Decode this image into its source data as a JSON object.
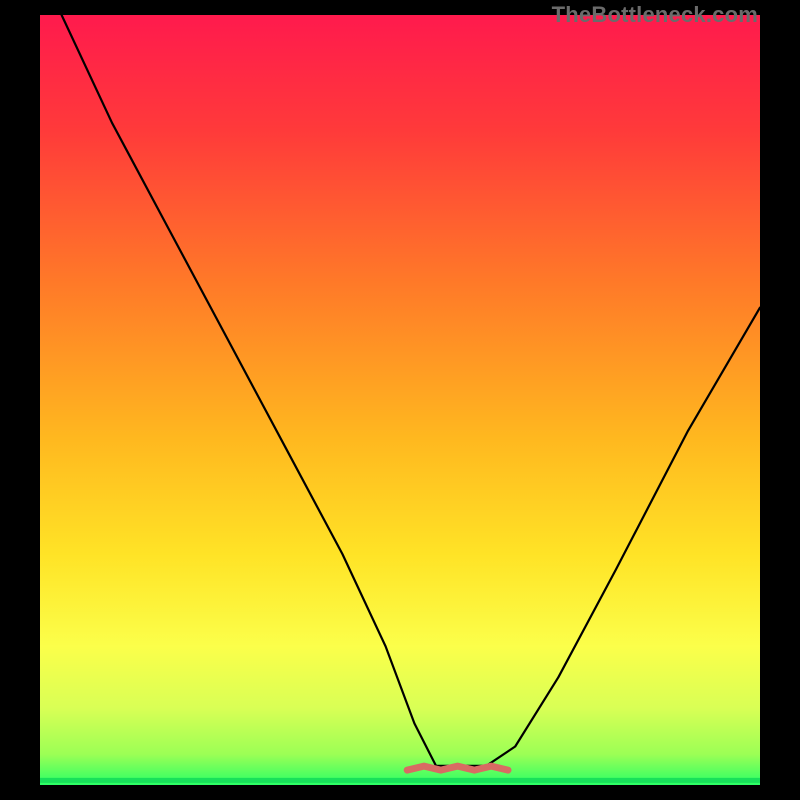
{
  "watermark": "TheBottleneck.com",
  "colors": {
    "curve": "#000000",
    "optimal_line": "#18e05a",
    "optimal_band": "#d86b63",
    "bg_black": "#000000"
  },
  "gradient_stops": [
    {
      "offset": 0.0,
      "color": "#ff1a4d"
    },
    {
      "offset": 0.15,
      "color": "#ff3a3a"
    },
    {
      "offset": 0.35,
      "color": "#ff7a28"
    },
    {
      "offset": 0.55,
      "color": "#ffb81f"
    },
    {
      "offset": 0.7,
      "color": "#ffe326"
    },
    {
      "offset": 0.82,
      "color": "#fbff4a"
    },
    {
      "offset": 0.9,
      "color": "#d9ff55"
    },
    {
      "offset": 0.96,
      "color": "#9cff55"
    },
    {
      "offset": 1.0,
      "color": "#2aff66"
    }
  ],
  "chart_data": {
    "type": "line",
    "title": "",
    "xlabel": "",
    "ylabel": "",
    "xlim": [
      0,
      100
    ],
    "ylim": [
      0,
      100
    ],
    "series": [
      {
        "name": "bottleneck-curve",
        "x": [
          3,
          10,
          18,
          26,
          34,
          42,
          48,
          52,
          55,
          58,
          62,
          66,
          72,
          80,
          90,
          100
        ],
        "y": [
          100,
          86,
          72,
          58,
          44,
          30,
          18,
          8,
          2.5,
          2.5,
          2.5,
          5,
          14,
          28,
          46,
          62
        ]
      }
    ],
    "optimal_band": {
      "x_start": 51,
      "x_end": 65,
      "y": 2.2
    },
    "baseline": {
      "y": 0.6
    }
  }
}
